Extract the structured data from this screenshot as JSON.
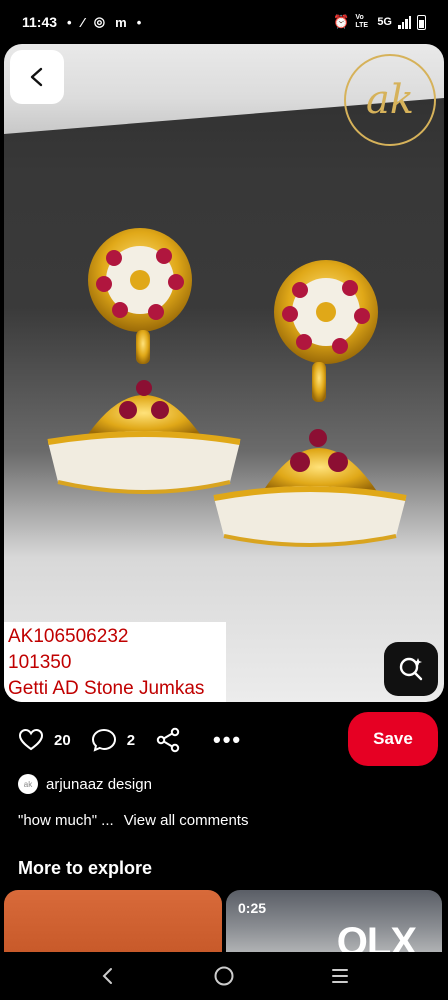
{
  "status_bar": {
    "time": "11:43",
    "network": "5G",
    "network_prefix": "Vo LTE"
  },
  "pin": {
    "logo_text": "ak",
    "caption_lines": [
      "AK106506232",
      "101350",
      "Getti AD Stone Jumkas"
    ]
  },
  "actions": {
    "likes": "20",
    "comments": "2",
    "more": "•••",
    "save_label": "Save"
  },
  "author": {
    "name": "arjunaaz design",
    "avatar_text": "ak"
  },
  "comments": {
    "preview": "\"how much\" ...",
    "view_all": "View all comments"
  },
  "explore": {
    "title": "More to explore",
    "thumb_right_time": "0:25",
    "thumb_right_brand": "OLX"
  },
  "colors": {
    "save": "#e60023",
    "caption_text": "#c00000",
    "logo_gold": "#d6b25a"
  }
}
